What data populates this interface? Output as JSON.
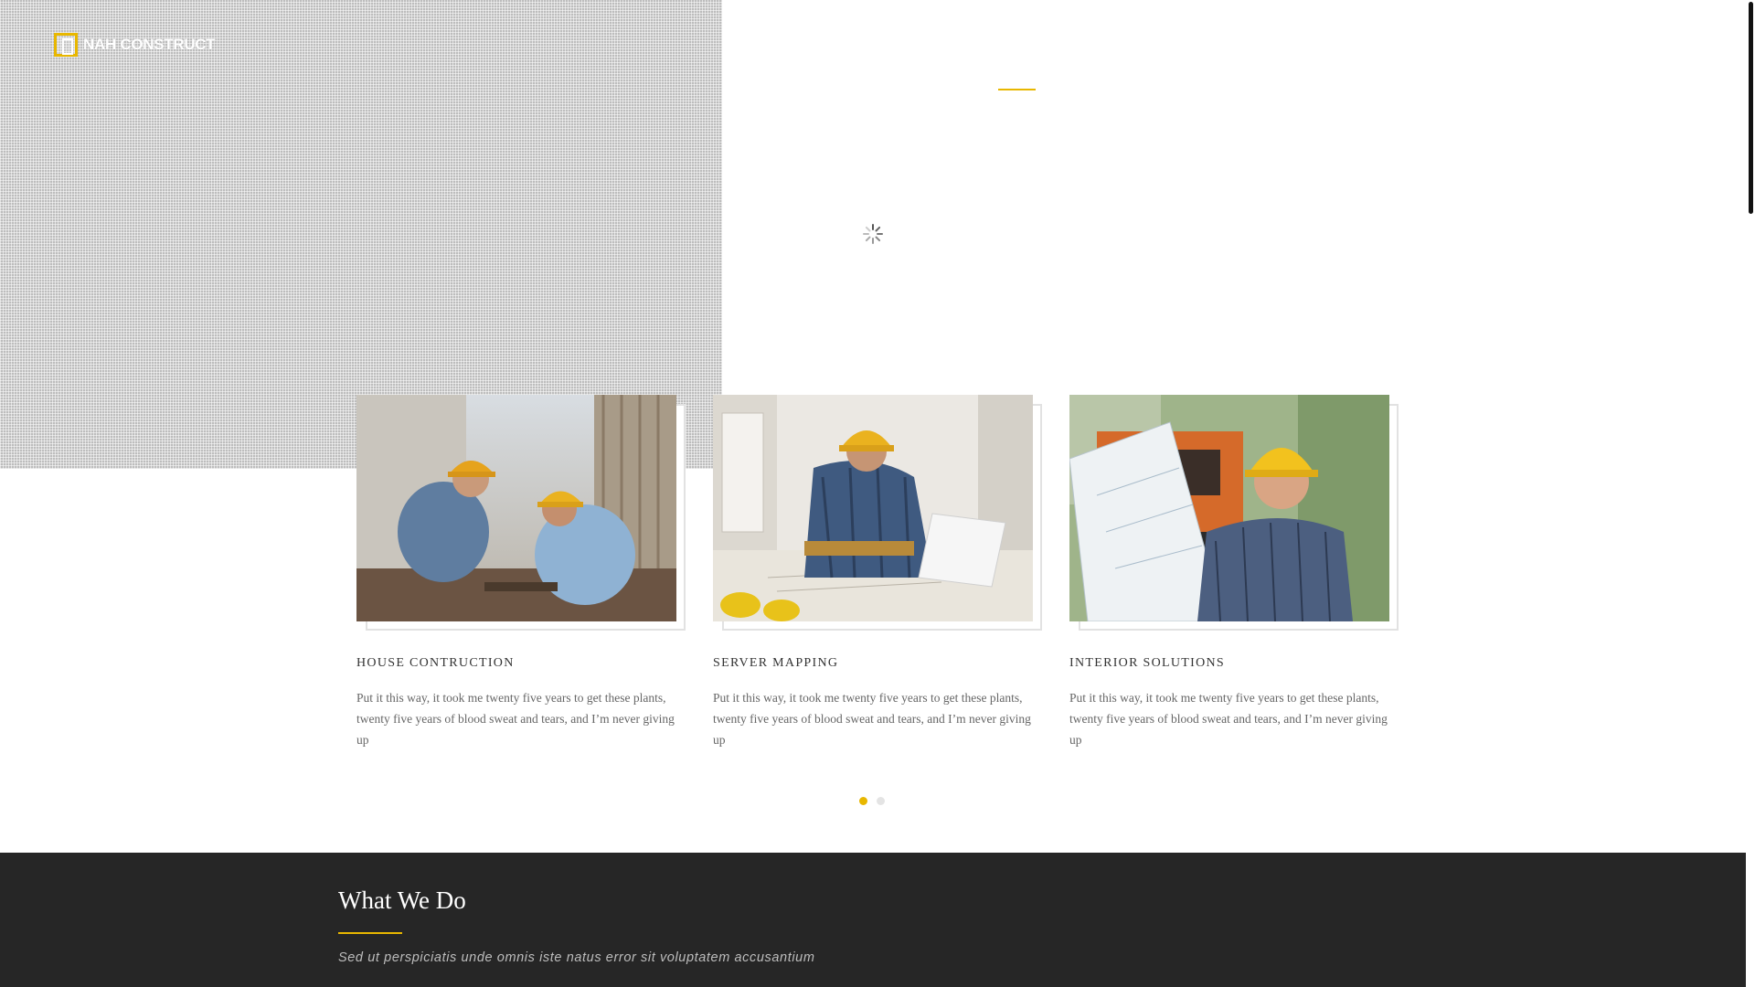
{
  "brand": {
    "name": "NAH CONSTRUCT",
    "accent_color": "#e8b700",
    "logo_icon": "building-square-icon"
  },
  "loader": {
    "icon": "loading-spinner-icon"
  },
  "services": [
    {
      "title": "HOUSE CONTRUCTION",
      "text": "Put it this way, it took me twenty five years to get these plants, twenty five years of blood sweat and tears, and I’m never giving up",
      "photo": "workers-at-site-photo"
    },
    {
      "title": "SERVER MAPPING",
      "text": "Put it this way, it took me twenty five years to get these plants, twenty five years of blood sweat and tears, and I’m never giving up",
      "photo": "engineer-with-laptop-photo"
    },
    {
      "title": "INTERIOR SOLUTIONS",
      "text": "Put it this way, it took me twenty five years to get these plants, twenty five years of blood sweat and tears, and I’m never giving up",
      "photo": "worker-with-blueprint-photo"
    }
  ],
  "carousel": {
    "pages": 2,
    "active_page": 1
  },
  "what_we_do": {
    "title": "What We Do",
    "subtitle": "Sed ut perspiciatis unde omnis iste natus error sit voluptatem accusantium",
    "background": "#262626"
  }
}
